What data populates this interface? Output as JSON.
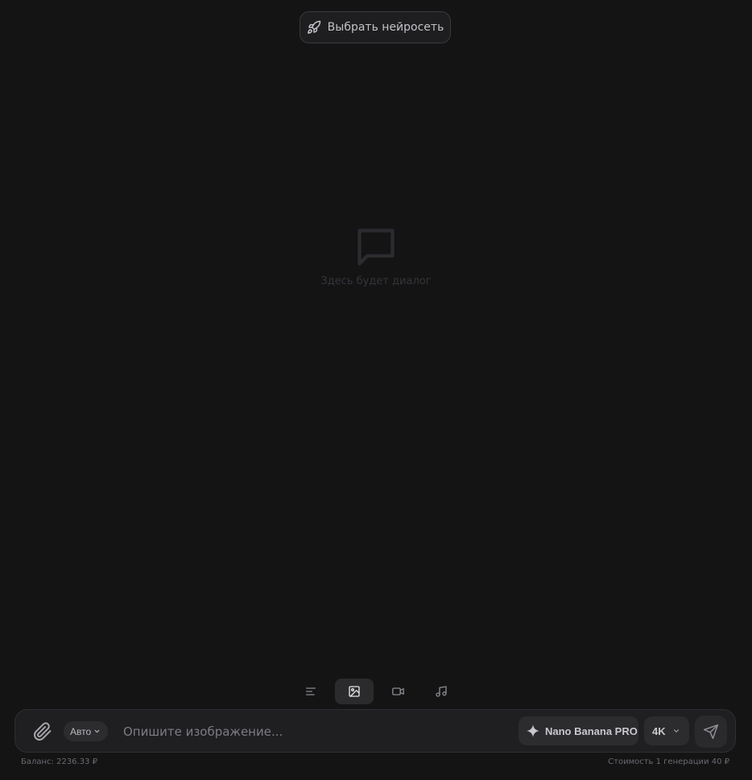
{
  "header": {
    "model_picker_label": "Выбрать нейросеть",
    "model_picker_icon": "rocket-icon"
  },
  "empty_state": {
    "icon": "chat-bubble-icon",
    "text": "Здесь будет диалог"
  },
  "modes": [
    {
      "id": "text",
      "icon": "text-lines-icon",
      "active": false
    },
    {
      "id": "image",
      "icon": "image-icon",
      "active": true
    },
    {
      "id": "video",
      "icon": "video-camera-icon",
      "active": false
    },
    {
      "id": "audio",
      "icon": "music-note-icon",
      "active": false
    }
  ],
  "composer": {
    "attach_icon": "paperclip-icon",
    "ratio_select_value": "Авто",
    "prompt_placeholder": "Опишите изображение...",
    "prompt_value": "",
    "model_chip_label": "Nano Banana PRO",
    "model_chip_icon": "sparkle-icon",
    "quality_value": "4K",
    "send_icon": "send-icon"
  },
  "footer": {
    "balance": "Баланс: 2236.33 ₽",
    "cost": "Стоимость 1 генерации 40 ₽"
  },
  "colors": {
    "background": "#141415",
    "surface": "#1f1f21",
    "chip": "#2c2c2f",
    "text_primary": "#c8c8cd",
    "text_muted": "#6a6a70"
  }
}
